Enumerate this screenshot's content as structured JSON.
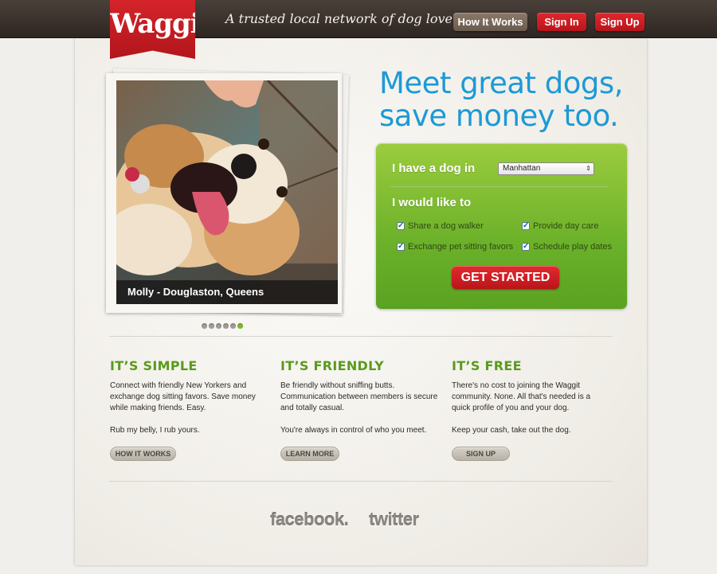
{
  "header": {
    "logo": "Waggit",
    "tagline": "A trusted local network of dog lovers.",
    "nav": {
      "how_it_works": "How It Works",
      "sign_in": "Sign In",
      "sign_up": "Sign Up"
    }
  },
  "hero": {
    "headline_line1": "Meet great dogs,",
    "headline_line2": "save money too.",
    "photo_caption": "Molly - Douglaston, Queens",
    "slides_total": 6,
    "slide_active": 6
  },
  "form": {
    "dog_label": "I have a dog in",
    "location_value": "Manhattan",
    "like_label": "I would like to",
    "options": [
      {
        "label": "Share a dog walker",
        "checked": true
      },
      {
        "label": "Provide day care",
        "checked": true
      },
      {
        "label": "Exchange pet sitting favors",
        "checked": true
      },
      {
        "label": "Schedule play dates",
        "checked": true
      }
    ],
    "submit_label": "GET STARTED"
  },
  "features": [
    {
      "title": "IT’S SIMPLE",
      "text": "Connect with friendly New Yorkers and exchange dog sitting favors. Save money while making friends. Easy.",
      "text2": "Rub my belly, I rub yours.",
      "button": "HOW IT WORKS"
    },
    {
      "title": "IT’S FRIENDLY",
      "text": "Be friendly without sniffing butts. Communication between members is secure and totally casual.",
      "text2": "You're always in control of who you meet.",
      "button": "LEARN MORE"
    },
    {
      "title": "IT’S FREE",
      "text": "There's no cost to joining the Waggit community. None. All that's needed is a quick profile of you and your dog.",
      "text2": "Keep your cash, take out the dog.",
      "button": "SIGN UP"
    }
  ],
  "social": {
    "facebook": "facebook.",
    "twitter": "twitter"
  },
  "colors": {
    "accent_blue": "#1c9ad6",
    "brand_red": "#d4242a",
    "form_green": "#6bb12a",
    "heading_green": "#5a9a1e"
  }
}
